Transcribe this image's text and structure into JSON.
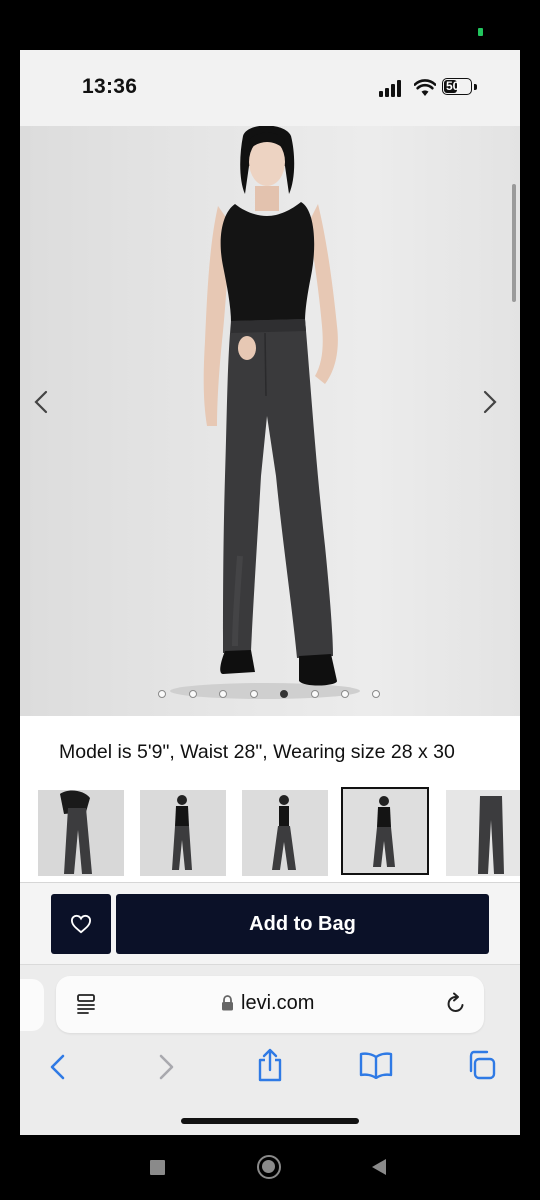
{
  "status_bar": {
    "time": "13:36",
    "battery_level": "50",
    "icons": [
      "signal-icon",
      "wifi-icon",
      "battery-icon"
    ]
  },
  "product_gallery": {
    "image_count": 8,
    "active_index": 4,
    "prev_icon": "chevron-left-icon",
    "next_icon": "chevron-right-icon",
    "model_info": "Model is 5'9\", Waist 28\", Wearing size 28 x 30",
    "thumbnails": [
      "thumb-1",
      "thumb-2",
      "thumb-3",
      "thumb-4",
      "thumb-5"
    ],
    "selected_thumbnail": 3
  },
  "actions": {
    "favorite_icon": "heart-icon",
    "add_to_bag_label": "Add to Bag"
  },
  "browser": {
    "url": "levi.com",
    "toolbar_icons": [
      "back-icon",
      "forward-icon",
      "share-icon",
      "bookmarks-icon",
      "tabs-icon"
    ]
  },
  "colors": {
    "primary_button": "#0b1128",
    "accent_blue": "#2f7ae5",
    "jeans": "#3a3a3c",
    "top": "#141414"
  }
}
